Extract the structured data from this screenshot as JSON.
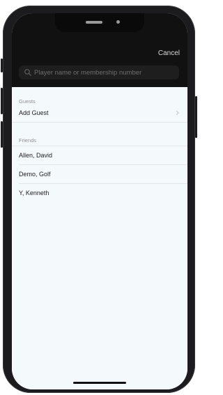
{
  "header": {
    "cancel_label": "Cancel"
  },
  "search": {
    "placeholder": "Player name or membership number",
    "value": ""
  },
  "sections": {
    "guests": {
      "title": "Guests",
      "add_guest_label": "Add Guest"
    },
    "friends": {
      "title": "Friends",
      "items": [
        {
          "name": "Allen, David"
        },
        {
          "name": "Demo, Golf"
        },
        {
          "name": "Y, Kenneth"
        }
      ]
    }
  },
  "colors": {
    "header_bg": "#111111",
    "screen_bg": "#f4f9fc",
    "phone_frame": "#1c1c1e",
    "section_text": "#8e8e93",
    "row_text": "#1c1c1e"
  },
  "icons": {
    "search": "search-icon",
    "chevron": "chevron-right-icon"
  }
}
